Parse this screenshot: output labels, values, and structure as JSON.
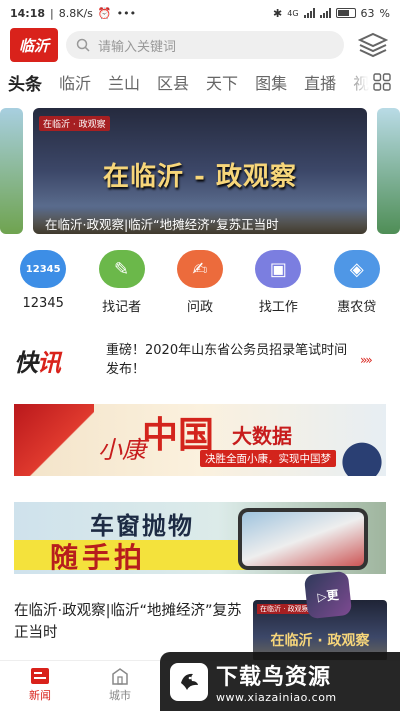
{
  "status_bar": {
    "time": "14:18",
    "speed": "8.8K/s",
    "dots": "•••",
    "network": "4G",
    "battery_percent": "63"
  },
  "header": {
    "logo_text": "临沂",
    "search_placeholder": "请输入关键词"
  },
  "tabs": [
    {
      "label": "头条",
      "active": true
    },
    {
      "label": "临沂",
      "active": false
    },
    {
      "label": "兰山",
      "active": false
    },
    {
      "label": "区县",
      "active": false
    },
    {
      "label": "天下",
      "active": false
    },
    {
      "label": "图集",
      "active": false
    },
    {
      "label": "直播",
      "active": false
    },
    {
      "label": "视",
      "active": false
    }
  ],
  "banner": {
    "tagline": "在临沂 · 政观察",
    "headline": "在临沂 - 政观察",
    "caption": "在临沂·政观察|临沂“地摊经济”复苏正当时"
  },
  "quick_links": [
    {
      "label": "12345",
      "icon_text": "12345",
      "icon": "phone-number-icon",
      "color": "#3d8ee6"
    },
    {
      "label": "找记者",
      "icon_text": "✎",
      "icon": "reporter-icon",
      "color": "#6bb84a"
    },
    {
      "label": "问政",
      "icon_text": "✍",
      "icon": "petition-icon",
      "color": "#ec6b3c"
    },
    {
      "label": "找工作",
      "icon_text": "▣",
      "icon": "job-icon",
      "color": "#7b7ee0"
    },
    {
      "label": "惠农贷",
      "icon_text": "◈",
      "icon": "loan-icon",
      "color": "#4f97e6"
    }
  ],
  "kuaixun": {
    "logo_a": "快",
    "logo_b": "讯",
    "text": "重磅！2020年山东省公务员招录笔试时间发布！",
    "more": "»»"
  },
  "ad1": {
    "small": "小康",
    "big": "中国",
    "suffix": "大数据",
    "subtitle": "决胜全面小康，实现中国梦"
  },
  "ad2": {
    "line1": "车窗抛物",
    "line2": "随手拍"
  },
  "news": {
    "title": "在临沂·政观察|临沂“地摊经济”复苏正当时",
    "thumb_tag": "在临沂 · 政观察",
    "thumb_headline": "在临沂 · 政观察",
    "video_badge": "▷更"
  },
  "bottom_nav": [
    {
      "label": "新闻",
      "active": true
    },
    {
      "label": "城市",
      "active": false
    }
  ],
  "watermark": {
    "title": "下载鸟资源",
    "url": "www.xiazainiao.com"
  },
  "colors": {
    "brand_red": "#d9221b",
    "search_bg": "#efefef"
  }
}
